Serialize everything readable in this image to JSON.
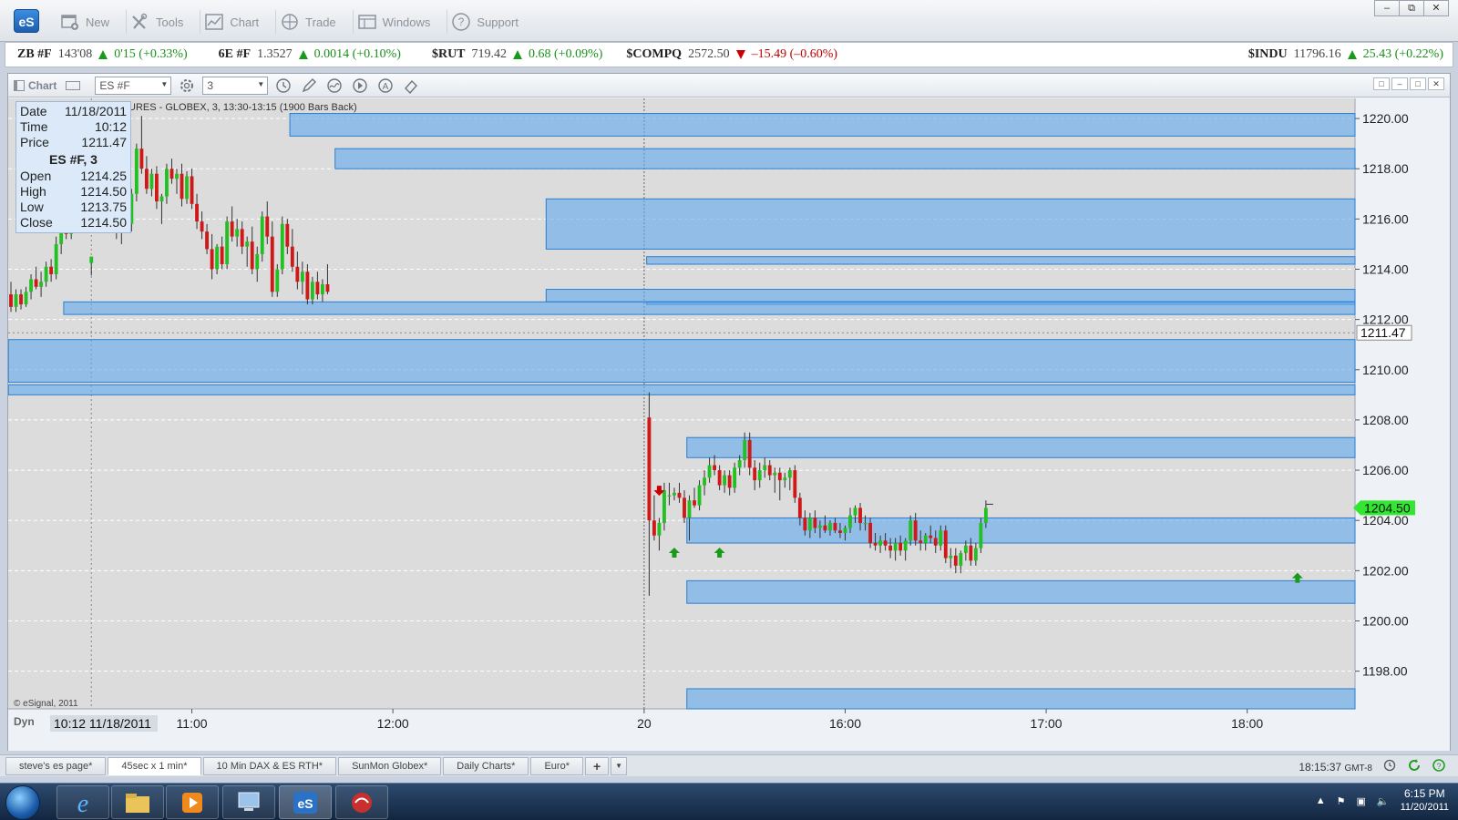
{
  "app": {
    "logo_text": "eS",
    "menu": [
      {
        "label": "New",
        "icon": "new-window-icon"
      },
      {
        "label": "Tools",
        "icon": "tools-icon"
      },
      {
        "label": "Chart",
        "icon": "chart-icon"
      },
      {
        "label": "Trade",
        "icon": "trade-icon"
      },
      {
        "label": "Windows",
        "icon": "windows-icon"
      },
      {
        "label": "Support",
        "icon": "support-icon"
      }
    ]
  },
  "ticker": [
    {
      "sym": "ZB #F",
      "last": "143'08",
      "chg": "0'15 (+0.33%)",
      "dir": "up"
    },
    {
      "sym": "6E #F",
      "last": "1.3527",
      "chg": "0.0014 (+0.10%)",
      "dir": "up"
    },
    {
      "sym": "$RUT",
      "last": "719.42",
      "chg": "0.68 (+0.09%)",
      "dir": "up"
    },
    {
      "sym": "$COMPQ",
      "last": "2572.50",
      "chg": "–15.49 (–0.60%)",
      "dir": "down"
    },
    {
      "sym": "$INDU",
      "last": "11796.16",
      "chg": "25.43 (+0.22%)",
      "dir": "up"
    }
  ],
  "chart_toolbar": {
    "label": "Chart",
    "symbol": "ES #F",
    "interval": "3"
  },
  "info_box": {
    "date_label": "Date",
    "date": "11/18/2011",
    "time_label": "Time",
    "time": "10:12",
    "price_label": "Price",
    "price": "1211.47",
    "title": "ES #F, 3",
    "open_label": "Open",
    "open": "1214.25",
    "high_label": "High",
    "high": "1214.50",
    "low_label": "Low",
    "low": "1213.75",
    "close_label": "Close",
    "close": "1214.50"
  },
  "chart_header": "URES - GLOBEX, 3, 13:30-13:15 (1900 Bars Back)",
  "copyright": "© eSignal, 2011",
  "dyn_label": "Dyn",
  "cursor_time_label": "10:12 11/18/2011",
  "colors": {
    "up": "#22c022",
    "down": "#d01818",
    "zone_fill": "#64aaeb",
    "zone_stroke": "#2a7fd0",
    "price_marker": "#ffffff",
    "last_marker": "#32e632"
  },
  "chart_data": {
    "type": "candlestick",
    "y_ticks": [
      "1220.00",
      "1218.00",
      "1216.00",
      "1214.00",
      "1212.00",
      "1210.00",
      "1208.00",
      "1206.00",
      "1204.00",
      "1202.00",
      "1200.00",
      "1198.00"
    ],
    "ylim": [
      1196.5,
      1220.8
    ],
    "x_ticks": [
      {
        "label": "11:00",
        "bar": 36
      },
      {
        "label": "12:00",
        "bar": 76
      },
      {
        "label": "20",
        "bar": 126
      },
      {
        "label": "16:00",
        "bar": 166
      },
      {
        "label": "17:00",
        "bar": 206
      },
      {
        "label": "18:00",
        "bar": 246
      }
    ],
    "cursor_price": "1211.47",
    "last_price": "1204.50",
    "cursor_bar": 16,
    "session_break_bar": 126,
    "total_bars": 268,
    "zones": [
      {
        "from_bar": 56,
        "y1": 1219.3,
        "y2": 1220.2
      },
      {
        "from_bar": 65,
        "y1": 1218.0,
        "y2": 1218.8
      },
      {
        "from_bar": 107,
        "y1": 1214.8,
        "y2": 1216.8
      },
      {
        "from_bar": 127,
        "y1": 1214.2,
        "y2": 1214.5
      },
      {
        "from_bar": 107,
        "y1": 1212.7,
        "y2": 1213.2
      },
      {
        "from_bar": 127,
        "y1": 1212.6,
        "y2": 1212.7
      },
      {
        "from_bar": 11,
        "y1": 1212.2,
        "y2": 1212.7
      },
      {
        "from_bar": 0,
        "y1": 1209.5,
        "y2": 1211.2
      },
      {
        "from_bar": 0,
        "y1": 1209.0,
        "y2": 1209.4
      },
      {
        "from_bar": 135,
        "y1": 1206.5,
        "y2": 1207.3
      },
      {
        "from_bar": 135,
        "y1": 1203.1,
        "y2": 1204.1
      },
      {
        "from_bar": 135,
        "y1": 1200.7,
        "y2": 1201.6
      },
      {
        "from_bar": 135,
        "y1": 1196.5,
        "y2": 1197.3
      }
    ],
    "candles_day1": [
      [
        1213.0,
        1213.5,
        1212.3,
        1212.5
      ],
      [
        1212.5,
        1213.2,
        1212.3,
        1213.0
      ],
      [
        1213.0,
        1213.2,
        1212.4,
        1212.6
      ],
      [
        1212.6,
        1213.3,
        1212.5,
        1213.1
      ],
      [
        1213.1,
        1213.8,
        1212.8,
        1213.6
      ],
      [
        1213.6,
        1214.1,
        1213.2,
        1213.3
      ],
      [
        1213.3,
        1213.9,
        1212.9,
        1213.5
      ],
      [
        1213.5,
        1214.3,
        1213.3,
        1214.1
      ],
      [
        1214.1,
        1214.4,
        1213.5,
        1213.8
      ],
      [
        1213.8,
        1215.3,
        1213.6,
        1215.0
      ],
      [
        1215.0,
        1216.0,
        1214.6,
        1215.6
      ],
      [
        1215.6,
        1216.2,
        1215.2,
        1215.4
      ],
      [
        1215.4,
        1216.8,
        1215.2,
        1216.6
      ],
      [
        1216.6,
        1217.6,
        1216.3,
        1217.4
      ],
      [
        1217.4,
        1218.6,
        1217.0,
        1218.3
      ],
      [
        1218.3,
        1218.9,
        1217.4,
        1217.6
      ],
      [
        1214.25,
        1214.5,
        1213.75,
        1214.5
      ],
      [
        1217.6,
        1218.5,
        1216.9,
        1218.1
      ],
      [
        1218.1,
        1218.6,
        1217.1,
        1217.3
      ],
      [
        1217.3,
        1218.3,
        1217.0,
        1218.0
      ],
      [
        1218.0,
        1218.4,
        1216.8,
        1217.1
      ],
      [
        1217.1,
        1217.6,
        1215.2,
        1215.5
      ],
      [
        1215.5,
        1216.4,
        1215.0,
        1216.2
      ],
      [
        1216.2,
        1216.8,
        1215.6,
        1215.8
      ],
      [
        1215.8,
        1217.2,
        1215.5,
        1217.0
      ],
      [
        1217.0,
        1219.0,
        1216.7,
        1218.8
      ],
      [
        1218.8,
        1220.1,
        1217.8,
        1218.0
      ],
      [
        1218.0,
        1218.5,
        1217.0,
        1217.2
      ],
      [
        1217.2,
        1218.0,
        1216.9,
        1217.8
      ],
      [
        1217.8,
        1218.1,
        1216.4,
        1216.7
      ],
      [
        1216.7,
        1217.0,
        1215.8,
        1216.9
      ],
      [
        1216.9,
        1218.2,
        1216.6,
        1218.0
      ],
      [
        1218.0,
        1218.4,
        1217.4,
        1217.6
      ],
      [
        1217.6,
        1218.0,
        1217.0,
        1217.8
      ],
      [
        1217.8,
        1218.2,
        1216.5,
        1216.8
      ],
      [
        1216.8,
        1217.9,
        1216.6,
        1217.7
      ],
      [
        1217.7,
        1218.0,
        1216.4,
        1216.6
      ],
      [
        1216.6,
        1217.0,
        1215.6,
        1215.9
      ],
      [
        1215.9,
        1216.3,
        1215.2,
        1215.5
      ],
      [
        1215.5,
        1215.8,
        1214.6,
        1214.8
      ],
      [
        1214.8,
        1215.4,
        1213.6,
        1214.0
      ],
      [
        1214.0,
        1215.0,
        1213.8,
        1214.9
      ],
      [
        1214.9,
        1215.3,
        1214.0,
        1214.2
      ],
      [
        1214.2,
        1216.1,
        1214.0,
        1215.9
      ],
      [
        1215.9,
        1216.5,
        1215.1,
        1215.3
      ],
      [
        1215.3,
        1216.0,
        1214.9,
        1215.6
      ],
      [
        1215.6,
        1215.9,
        1214.6,
        1214.9
      ],
      [
        1214.9,
        1215.3,
        1214.1,
        1215.1
      ],
      [
        1215.1,
        1215.7,
        1213.8,
        1214.0
      ],
      [
        1214.0,
        1214.9,
        1213.5,
        1214.6
      ],
      [
        1214.6,
        1216.3,
        1214.3,
        1216.1
      ],
      [
        1216.1,
        1216.7,
        1215.0,
        1215.3
      ],
      [
        1215.3,
        1215.9,
        1212.9,
        1213.1
      ],
      [
        1213.1,
        1214.2,
        1212.9,
        1214.0
      ],
      [
        1214.0,
        1216.1,
        1213.8,
        1215.8
      ],
      [
        1215.8,
        1216.0,
        1214.6,
        1214.9
      ],
      [
        1214.9,
        1215.6,
        1213.9,
        1214.1
      ],
      [
        1214.1,
        1214.7,
        1213.2,
        1213.5
      ],
      [
        1213.5,
        1214.3,
        1213.0,
        1213.9
      ],
      [
        1213.9,
        1214.2,
        1212.6,
        1212.8
      ],
      [
        1212.8,
        1213.7,
        1212.6,
        1213.5
      ],
      [
        1213.5,
        1213.9,
        1212.8,
        1213.0
      ],
      [
        1213.0,
        1213.6,
        1212.7,
        1213.4
      ],
      [
        1213.4,
        1214.2,
        1213.0,
        1213.1
      ]
    ],
    "candles_day2": [
      [
        1208.1,
        1209.1,
        1201.0,
        1204.0
      ],
      [
        1204.0,
        1205.0,
        1203.2,
        1203.4
      ],
      [
        1203.4,
        1204.1,
        1202.8,
        1203.9
      ],
      [
        1203.9,
        1205.5,
        1203.6,
        1205.2
      ],
      [
        1205.0,
        1205.5,
        1204.6,
        1205.0
      ],
      [
        1205.0,
        1205.3,
        1204.8,
        1205.1
      ],
      [
        1205.1,
        1205.5,
        1204.7,
        1204.9
      ],
      [
        1204.9,
        1205.2,
        1203.9,
        1204.1
      ],
      [
        1204.1,
        1205.0,
        1203.2,
        1204.8
      ],
      [
        1204.8,
        1205.3,
        1204.5,
        1204.6
      ],
      [
        1204.6,
        1205.6,
        1204.4,
        1205.4
      ],
      [
        1205.4,
        1206.0,
        1205.0,
        1205.7
      ],
      [
        1205.7,
        1206.5,
        1205.5,
        1206.2
      ],
      [
        1206.2,
        1206.6,
        1205.8,
        1206.0
      ],
      [
        1206.0,
        1206.2,
        1205.2,
        1205.4
      ],
      [
        1205.4,
        1206.0,
        1205.1,
        1205.8
      ],
      [
        1205.8,
        1206.0,
        1205.0,
        1205.3
      ],
      [
        1205.3,
        1206.3,
        1205.1,
        1206.1
      ],
      [
        1206.1,
        1206.6,
        1205.8,
        1206.4
      ],
      [
        1206.4,
        1207.5,
        1206.1,
        1207.2
      ],
      [
        1207.2,
        1207.5,
        1205.8,
        1206.1
      ],
      [
        1206.1,
        1206.4,
        1205.2,
        1205.6
      ],
      [
        1205.6,
        1206.3,
        1205.3,
        1206.0
      ],
      [
        1206.0,
        1206.5,
        1205.7,
        1206.2
      ],
      [
        1206.2,
        1206.4,
        1205.6,
        1205.8
      ],
      [
        1205.8,
        1206.1,
        1205.1,
        1205.9
      ],
      [
        1205.9,
        1206.1,
        1204.8,
        1205.6
      ],
      [
        1205.6,
        1205.9,
        1205.3,
        1205.7
      ],
      [
        1205.7,
        1206.1,
        1205.2,
        1206.0
      ],
      [
        1206.0,
        1206.2,
        1204.7,
        1204.9
      ],
      [
        1204.9,
        1205.1,
        1203.8,
        1204.1
      ],
      [
        1204.1,
        1204.4,
        1203.4,
        1203.6
      ],
      [
        1203.6,
        1204.3,
        1203.3,
        1204.1
      ],
      [
        1204.1,
        1204.4,
        1203.5,
        1203.7
      ],
      [
        1203.7,
        1204.0,
        1203.3,
        1203.8
      ],
      [
        1203.8,
        1204.2,
        1203.5,
        1203.6
      ],
      [
        1203.6,
        1204.0,
        1203.4,
        1203.9
      ],
      [
        1203.9,
        1204.1,
        1203.5,
        1203.6
      ],
      [
        1203.6,
        1203.9,
        1203.3,
        1203.5
      ],
      [
        1203.5,
        1203.8,
        1203.2,
        1203.7
      ],
      [
        1203.7,
        1204.5,
        1203.5,
        1204.2
      ],
      [
        1204.2,
        1204.6,
        1203.9,
        1204.5
      ],
      [
        1204.5,
        1204.7,
        1203.6,
        1203.9
      ],
      [
        1203.9,
        1204.2,
        1203.6,
        1203.9
      ],
      [
        1203.9,
        1204.1,
        1202.9,
        1203.1
      ],
      [
        1203.1,
        1203.5,
        1202.8,
        1203.0
      ],
      [
        1203.0,
        1203.4,
        1202.7,
        1203.2
      ],
      [
        1203.2,
        1203.5,
        1202.8,
        1203.0
      ],
      [
        1203.0,
        1203.3,
        1202.5,
        1202.8
      ],
      [
        1202.8,
        1203.3,
        1202.4,
        1203.1
      ],
      [
        1203.1,
        1203.4,
        1202.6,
        1202.8
      ],
      [
        1202.8,
        1203.3,
        1202.4,
        1203.2
      ],
      [
        1203.2,
        1204.2,
        1203.0,
        1204.0
      ],
      [
        1204.0,
        1204.3,
        1203.0,
        1203.2
      ],
      [
        1203.2,
        1203.6,
        1202.8,
        1203.1
      ],
      [
        1203.1,
        1203.5,
        1202.8,
        1203.4
      ],
      [
        1203.4,
        1203.8,
        1203.1,
        1203.3
      ],
      [
        1203.3,
        1203.6,
        1202.7,
        1203.0
      ],
      [
        1203.0,
        1203.8,
        1202.8,
        1203.6
      ],
      [
        1203.6,
        1203.8,
        1202.3,
        1202.5
      ],
      [
        1202.5,
        1202.9,
        1202.1,
        1202.6
      ],
      [
        1202.6,
        1202.9,
        1201.9,
        1202.2
      ],
      [
        1202.2,
        1202.8,
        1201.9,
        1202.7
      ],
      [
        1202.7,
        1203.2,
        1202.4,
        1203.0
      ],
      [
        1203.0,
        1203.3,
        1202.2,
        1202.4
      ],
      [
        1202.4,
        1203.1,
        1202.2,
        1202.9
      ],
      [
        1202.9,
        1204.1,
        1202.7,
        1203.9
      ],
      [
        1203.9,
        1204.8,
        1203.7,
        1204.5
      ]
    ],
    "arrows": [
      {
        "bar": 129,
        "price": 1205.2,
        "dir": "down"
      },
      {
        "bar": 132,
        "price": 1202.7,
        "dir": "up"
      },
      {
        "bar": 141,
        "price": 1202.7,
        "dir": "up"
      },
      {
        "bar": 256,
        "price": 1201.7,
        "dir": "up"
      }
    ]
  },
  "tabs": [
    "steve's es page*",
    "45sec x 1 min*",
    "10 Min DAX & ES RTH*",
    "SunMon Globex*",
    "Daily Charts*",
    "Euro*"
  ],
  "active_tab": 1,
  "status_time": "18:15:37",
  "status_tz": "GMT-8",
  "taskbar": {
    "clock_time": "6:15 PM",
    "clock_date": "11/20/2011",
    "apps": [
      "internet-explorer-icon",
      "file-explorer-icon",
      "media-player-icon",
      "remote-desktop-icon",
      "esignal-icon",
      "app-icon"
    ]
  }
}
